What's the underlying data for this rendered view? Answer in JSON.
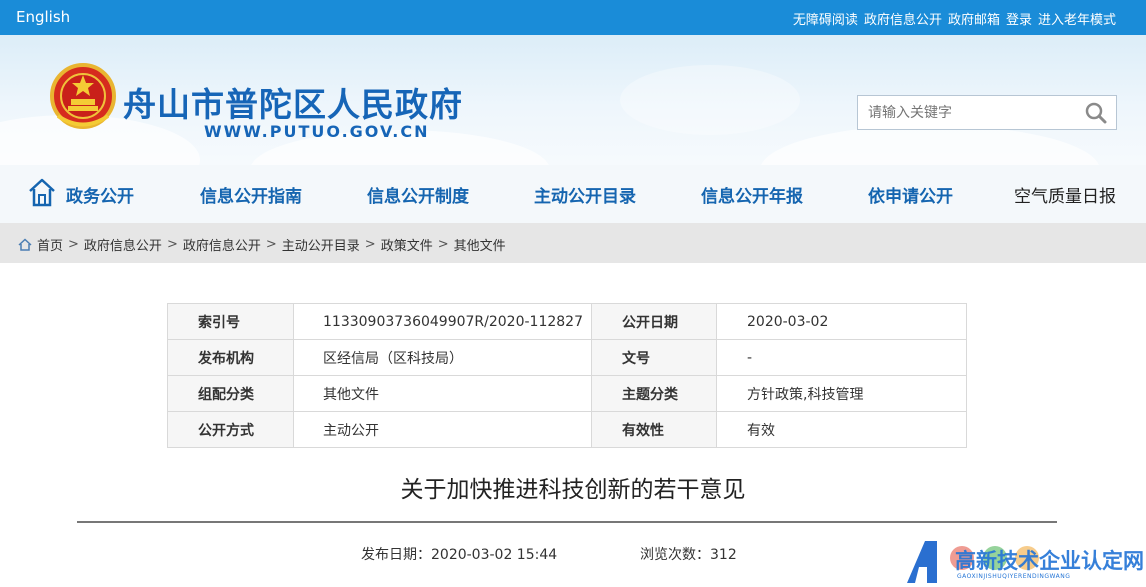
{
  "topbar": {
    "english": "English",
    "links": [
      "无障碍阅读",
      "政府信息公开",
      "政府邮箱",
      "登录",
      "进入老年模式"
    ]
  },
  "header": {
    "title": "舟山市普陀区人民政府",
    "url": "WWW.PUTUO.GOV.CN",
    "search_placeholder": "请输入关键字"
  },
  "nav": {
    "items": [
      "政务公开",
      "信息公开指南",
      "信息公开制度",
      "主动公开目录",
      "信息公开年报",
      "依申请公开",
      "空气质量日报"
    ]
  },
  "breadcrumb": [
    "首页",
    "政府信息公开",
    "政府信息公开",
    "主动公开目录",
    "政策文件",
    "其他文件"
  ],
  "info": {
    "rows": [
      {
        "label1": "索引号",
        "value1": "11330903736049907R/2020-112827",
        "label2": "公开日期",
        "value2": "2020-03-02"
      },
      {
        "label1": "发布机构",
        "value1": "区经信局（区科技局）",
        "label2": "文号",
        "value2": "-"
      },
      {
        "label1": "组配分类",
        "value1": "其他文件",
        "label2": "主题分类",
        "value2": "方针政策,科技管理"
      },
      {
        "label1": "公开方式",
        "value1": "主动公开",
        "label2": "有效性",
        "value2": "有效"
      }
    ]
  },
  "document": {
    "title": "关于加快推进科技创新的若干意见",
    "publish_date": "发布日期：2020-03-02 15:44",
    "views": "浏览次数：312"
  },
  "watermark": {
    "text": "高新技术企业认定网",
    "sub": "GAOXINJISHUQIYERENDINGWANG"
  },
  "colors": {
    "topbar": "#1a8cd8",
    "brand_blue": "#1665b7",
    "nav_text": "#1565b0"
  }
}
